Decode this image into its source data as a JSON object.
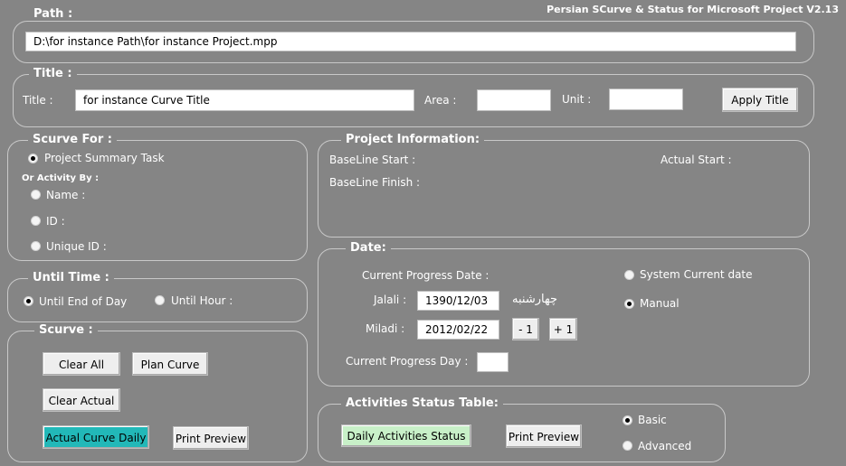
{
  "app_title": "Persian SCurve & Status for Microsoft Project V2.13",
  "path": {
    "legend": "Path :",
    "value": "D:\\for instance Path\\for instance Project.mpp"
  },
  "title_section": {
    "legend": "Title :",
    "title_label": "Title :",
    "title_value": "for instance Curve Title",
    "area_label": "Area :",
    "area_value": "",
    "unit_label": "Unit :",
    "unit_value": "",
    "apply_button": "Apply Title"
  },
  "scurve_for": {
    "legend": "Scurve For :",
    "summary_task": "Project Summary Task",
    "or_activity_by": "Or Activity By :",
    "name": "Name :",
    "id": "ID :",
    "unique_id": "Unique ID :",
    "selected": "summary_task"
  },
  "project_info": {
    "legend": "Project Information:",
    "baseline_start": "BaseLine Start :",
    "baseline_finish": "BaseLine Finish :",
    "actual_start": "Actual Start :"
  },
  "until_time": {
    "legend": "Until Time :",
    "end_of_day": "Until End of Day",
    "until_hour": "Until Hour :",
    "selected": "end_of_day"
  },
  "date": {
    "legend": "Date:",
    "current_progress_date": "Current Progress Date :",
    "system_current_date": "System Current date",
    "manual": "Manual",
    "selected": "manual",
    "jalali_label": "Jalali :",
    "jalali_value": "1390/12/03",
    "weekday_persian": "چهارشنبه",
    "miladi_label": "Miladi :",
    "miladi_value": "2012/02/22",
    "minus_button": "- 1",
    "plus_button": "+ 1",
    "current_progress_day": "Current Progress Day :",
    "progress_day_value": ""
  },
  "scurve": {
    "legend": "Scurve :",
    "clear_all": "Clear All",
    "plan_curve": "Plan Curve",
    "clear_actual": "Clear Actual",
    "actual_curve_daily": "Actual Curve Daily",
    "print_preview": "Print Preview"
  },
  "activities": {
    "legend": "Activities Status Table:",
    "daily_status": "Daily Activities Status",
    "print_preview": "Print Preview",
    "basic": "Basic",
    "advanced": "Advanced",
    "selected": "basic"
  },
  "colors": {
    "background": "#858585",
    "actual_curve_button": "#22b8b8",
    "daily_status_button": "#c8f0c8"
  }
}
